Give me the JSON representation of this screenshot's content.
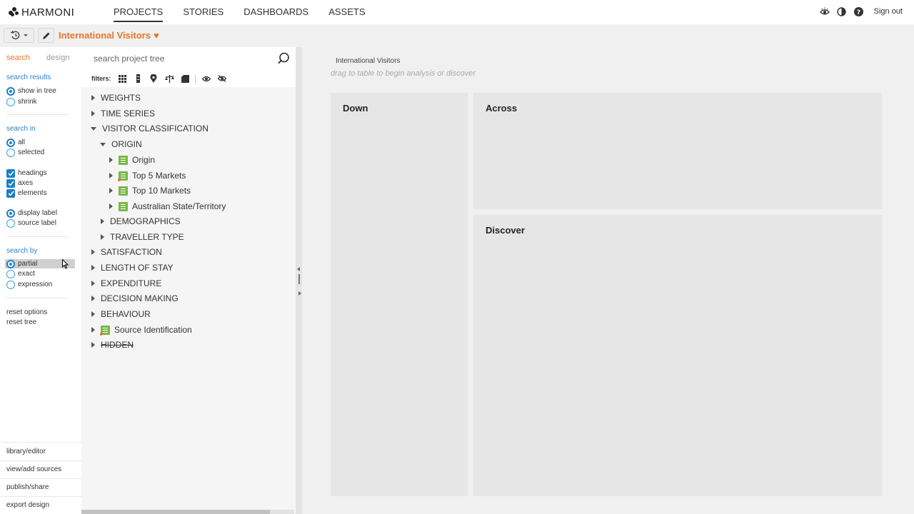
{
  "app": {
    "logo_text": "HARMONI"
  },
  "nav": {
    "links": [
      "PROJECTS",
      "STORIES",
      "DASHBOARDS",
      "ASSETS"
    ],
    "active": "PROJECTS",
    "sign_out": "Sign out"
  },
  "toolbar": {
    "project_title": "International Visitors"
  },
  "options": {
    "tabs": [
      "search",
      "design"
    ],
    "active_tab": "search",
    "search_results": {
      "title": "search results",
      "items": [
        "show in tree",
        "shrink"
      ],
      "selected": "show in tree"
    },
    "search_in": {
      "title": "search in",
      "items": [
        "all",
        "selected"
      ],
      "selected": "all"
    },
    "checks": [
      "headings",
      "axes",
      "elements"
    ],
    "label_type": {
      "items": [
        "display label",
        "source label"
      ],
      "selected": "display label"
    },
    "search_by": {
      "title": "search by",
      "items": [
        "partial",
        "exact",
        "expression"
      ],
      "selected": "partial"
    },
    "reset_options": "reset options",
    "reset_tree": "reset tree",
    "bottom_links": [
      "library/editor",
      "view/add sources",
      "publish/share",
      "export design"
    ]
  },
  "tree": {
    "search_placeholder": "search project tree",
    "filters_label": "filters:",
    "nodes": [
      {
        "label": "WEIGHTS"
      },
      {
        "label": "TIME SERIES"
      },
      {
        "label": "VISITOR CLASSIFICATION"
      },
      {
        "label": "ORIGIN"
      },
      {
        "label": "Origin"
      },
      {
        "label": "Top 5 Markets"
      },
      {
        "label": "Top 10 Markets"
      },
      {
        "label": "Australian State/Territory"
      },
      {
        "label": "DEMOGRAPHICS"
      },
      {
        "label": "TRAVELLER TYPE"
      },
      {
        "label": "SATISFACTION"
      },
      {
        "label": "LENGTH OF STAY"
      },
      {
        "label": "EXPENDITURE"
      },
      {
        "label": "DECISION MAKING"
      },
      {
        "label": "BEHAVIOUR"
      },
      {
        "label": "Source Identification"
      },
      {
        "label": "HIDDEN"
      }
    ]
  },
  "main": {
    "breadcrumb": "International Visitors",
    "hint": "drag to table to begin analysis or discover",
    "zones": {
      "down": "Down",
      "across": "Across",
      "discover": "Discover"
    }
  },
  "colors": {
    "accent": "#e8762b",
    "link_blue": "#2a82c9",
    "control_blue": "#1a7fc8",
    "element_green": "#7ab648"
  }
}
